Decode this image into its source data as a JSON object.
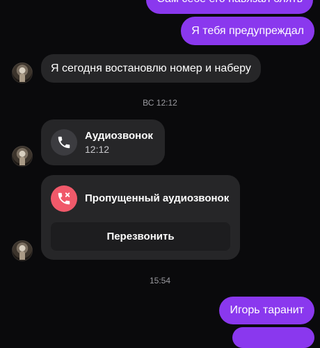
{
  "messages": {
    "out_top_partial": "Сам себе его навязал блять",
    "out_warned": "Я тебя предупреждал",
    "in_restore": "Я сегодня востановлю номер и наберу",
    "out_igor": "Игорь таранит"
  },
  "timestamps": {
    "sunday": "ВС 12:12",
    "evening": "15:54"
  },
  "audio_call": {
    "title": "Аудиозвонок",
    "time": "12:12",
    "icon": "phone-icon"
  },
  "missed_call": {
    "title": "Пропущенный аудиозвонок",
    "icon": "missed-call-icon",
    "callback_label": "Перезвонить"
  },
  "colors": {
    "background": "#0a0a0c",
    "outgoing_bubble": "#8a38ee",
    "incoming_bubble": "#262628",
    "missed_icon_bg": "#f0596a"
  }
}
